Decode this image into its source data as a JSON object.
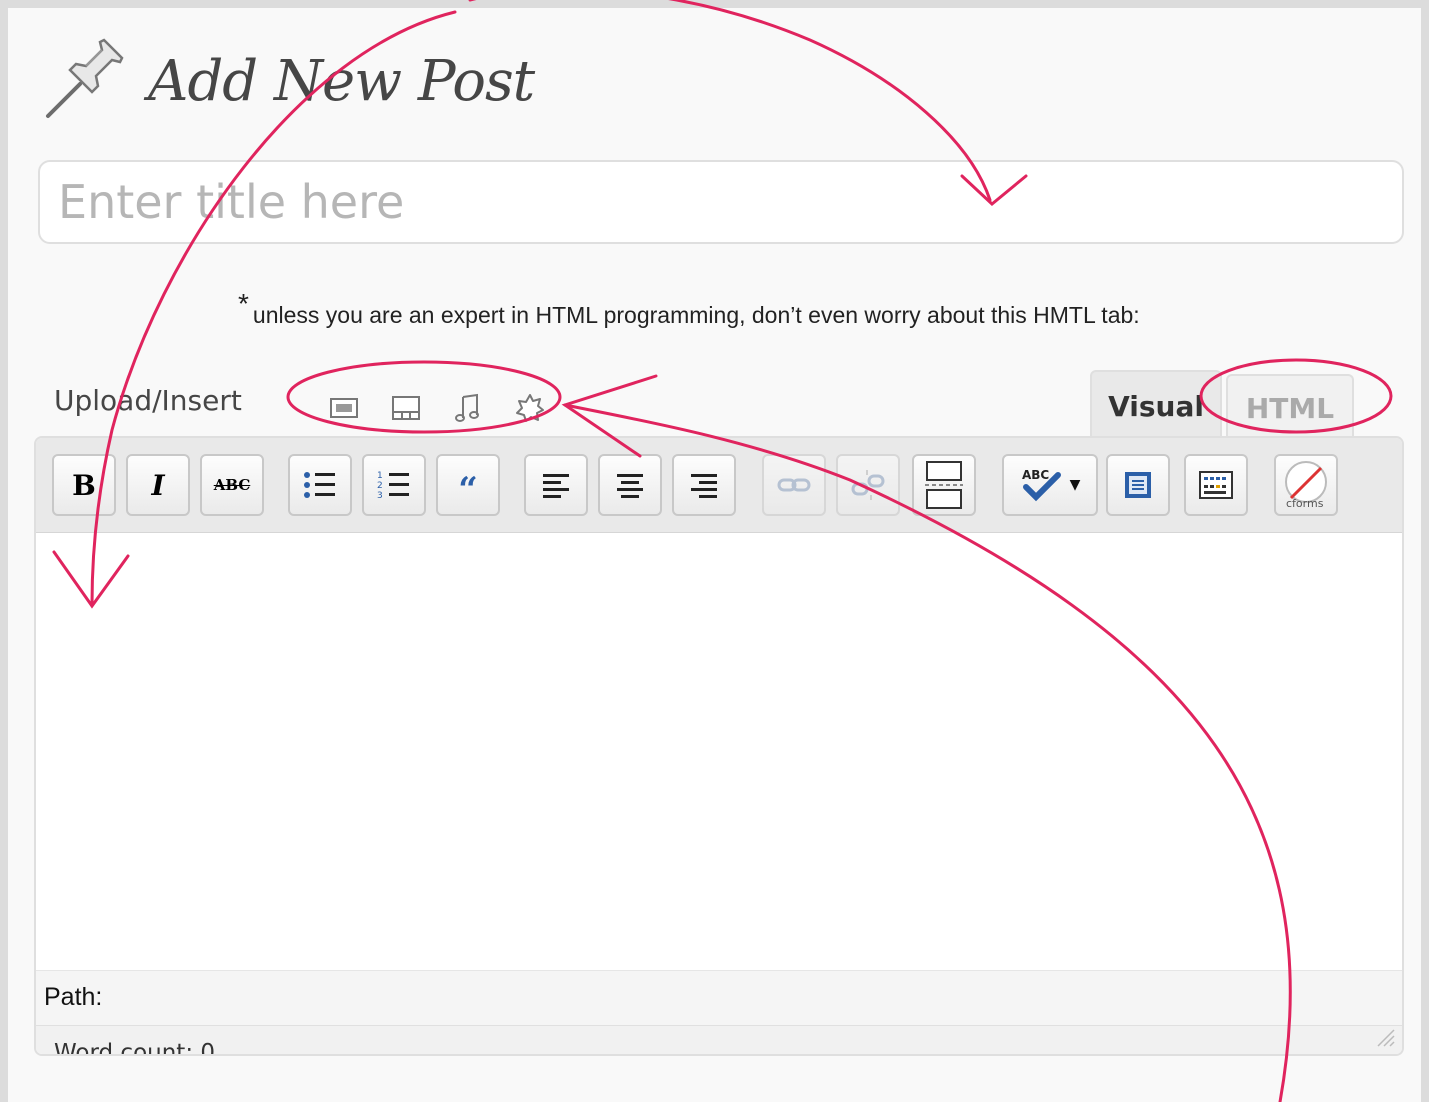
{
  "heading": {
    "title": "Add New Post"
  },
  "title_field": {
    "placeholder": "Enter title here",
    "value": ""
  },
  "note": {
    "asterisk": "*",
    "text": "unless you are an expert in HTML programming, don’t even worry about this HMTL tab:"
  },
  "upload": {
    "label": "Upload/Insert",
    "icons": [
      "add-image-icon",
      "add-video-icon",
      "add-audio-icon",
      "add-media-icon"
    ]
  },
  "tabs": [
    {
      "label": "Visual",
      "active": true
    },
    {
      "label": "HTML",
      "active": false
    }
  ],
  "toolbar": {
    "bold": "B",
    "italic": "I",
    "strikethrough": "ABC",
    "blockquote": "“",
    "spellcheck": "ABC",
    "cforms": "cforms"
  },
  "footer": {
    "path_label": "Path:",
    "word_count": "Word count: 0"
  },
  "colors": {
    "annotation": "#e0245e",
    "toolbar_bg": "#e9e9e9",
    "page_bg": "#f9f9f9"
  }
}
